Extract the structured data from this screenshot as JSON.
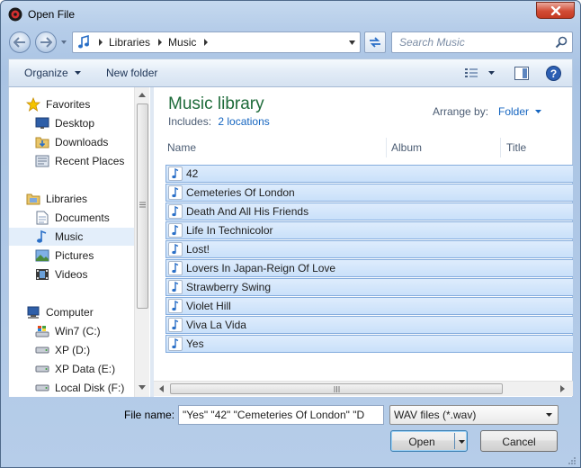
{
  "window": {
    "title": "Open File"
  },
  "address": {
    "segments": [
      "Libraries",
      "Music"
    ]
  },
  "search": {
    "placeholder": "Search Music"
  },
  "toolbar": {
    "organize_label": "Organize",
    "new_folder_label": "New folder"
  },
  "nav": {
    "favorites": {
      "label": "Favorites",
      "items": [
        "Desktop",
        "Downloads",
        "Recent Places"
      ]
    },
    "libraries": {
      "label": "Libraries",
      "items": [
        "Documents",
        "Music",
        "Pictures",
        "Videos"
      ],
      "selected": "Music"
    },
    "computer": {
      "label": "Computer",
      "items": [
        "Win7 (C:)",
        "XP (D:)",
        "XP Data (E:)",
        "Local Disk (F:)"
      ]
    }
  },
  "library": {
    "title": "Music library",
    "includes_label": "Includes:",
    "includes_link": "2 locations",
    "arrange_label": "Arrange by:",
    "arrange_value": "Folder"
  },
  "columns": [
    "Name",
    "Album",
    "Title"
  ],
  "files": [
    "42",
    "Cemeteries Of London",
    "Death And All His Friends",
    "Life In Technicolor",
    "Lost!",
    "Lovers In Japan-Reign Of Love",
    "Strawberry Swing",
    "Violet Hill",
    "Viva La Vida",
    "Yes"
  ],
  "filename": {
    "label": "File name:",
    "value": "\"Yes\" \"42\" \"Cemeteries Of London\" \"D"
  },
  "filetype": {
    "value": "WAV files (*.wav)"
  },
  "buttons": {
    "open": "Open",
    "cancel": "Cancel"
  },
  "colors": {
    "accent": "#1565c0",
    "library_title": "#1e6b3a",
    "selection": "#c9e0fa"
  }
}
